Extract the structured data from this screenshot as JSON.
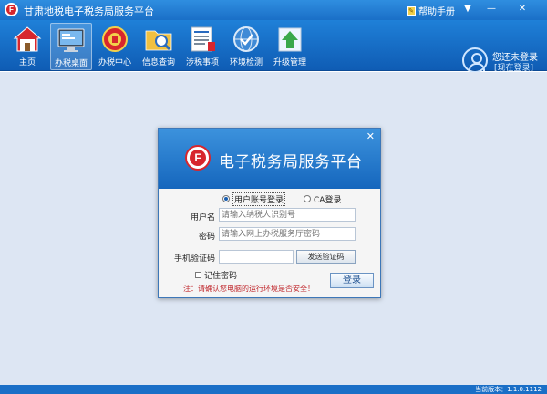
{
  "window": {
    "title": "甘肃地税电子税务局服务平台",
    "help_label": "帮助手册",
    "controls": {
      "menu": "▼",
      "minimize": "—",
      "close": "✕"
    }
  },
  "toolbar": {
    "items": [
      {
        "label": "主页",
        "icon": "home-icon"
      },
      {
        "label": "办税桌面",
        "icon": "desktop-icon"
      },
      {
        "label": "办税中心",
        "icon": "tax-center-icon"
      },
      {
        "label": "信息查询",
        "icon": "folder-search-icon"
      },
      {
        "label": "涉税事项",
        "icon": "document-list-icon"
      },
      {
        "label": "环境检测",
        "icon": "globe-check-icon"
      },
      {
        "label": "升级管理",
        "icon": "upgrade-arrow-icon"
      }
    ],
    "active_index": 1
  },
  "user": {
    "status": "您还未登录",
    "login_link": "[现在登录]"
  },
  "login_dialog": {
    "logo_letter": "F",
    "title": "电子税务局服务平台",
    "close": "✕",
    "modes": [
      "用户账号登录",
      "CA登录"
    ],
    "selected_mode": "用户账号登录",
    "username_label": "用户名",
    "username_placeholder": "请输入纳税人识别号",
    "password_label": "密码",
    "password_placeholder": "请输入网上办税服务厅密码",
    "sms_label": "手机验证码",
    "sms_button": "发送验证码",
    "remember_label": "记住密码",
    "notice": "注：请确认您电脑的运行环境是否安全！",
    "login_button": "登录"
  },
  "statusbar": {
    "version": "当前版本：1.1.0.1112"
  },
  "colors": {
    "accent": "#1a6fc7",
    "warning_text": "#c0282d",
    "workspace_bg": "#dde6f3"
  }
}
